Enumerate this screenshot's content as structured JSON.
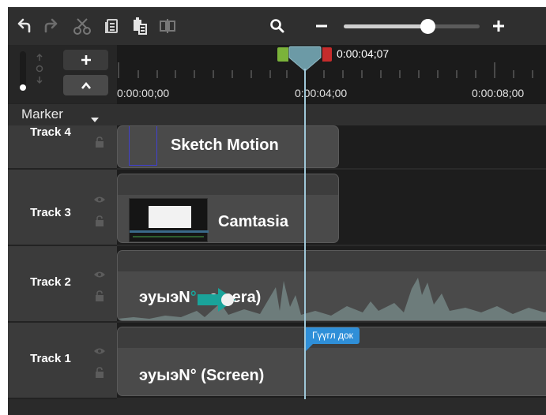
{
  "toolbar": {
    "items": [
      "undo-icon",
      "redo-icon",
      "cut-icon",
      "copy-icon",
      "paste-icon",
      "split-icon",
      "zoom-icon",
      "zoom-out-icon",
      "zoom-in-icon"
    ],
    "zoom_level": 0.62
  },
  "timeline": {
    "playhead_time": "0:00:04;07",
    "ruler_labels": [
      "0:00:00;00",
      "0:00:04;00",
      "0:00:08;00"
    ],
    "marker_label": "Marker",
    "marker_tag": "Гүүгл док"
  },
  "tracks": [
    {
      "name": "Track 4",
      "clip": "Sketch Motion"
    },
    {
      "name": "Track 3",
      "clip": "Camtasia"
    },
    {
      "name": "Track 2",
      "clip_before": "эуыэN",
      "clip_mid": "°",
      "clip_after": "amera)"
    },
    {
      "name": "Track 1",
      "clip": "эуыэN° (Screen)"
    }
  ],
  "colors": {
    "background": "#232323",
    "playhead": "#6c9aa6",
    "marker": "#2f8fd8",
    "in_point": "#7bb33a",
    "out_point": "#c62c2c",
    "camera_annotation": "#1aa39a"
  }
}
